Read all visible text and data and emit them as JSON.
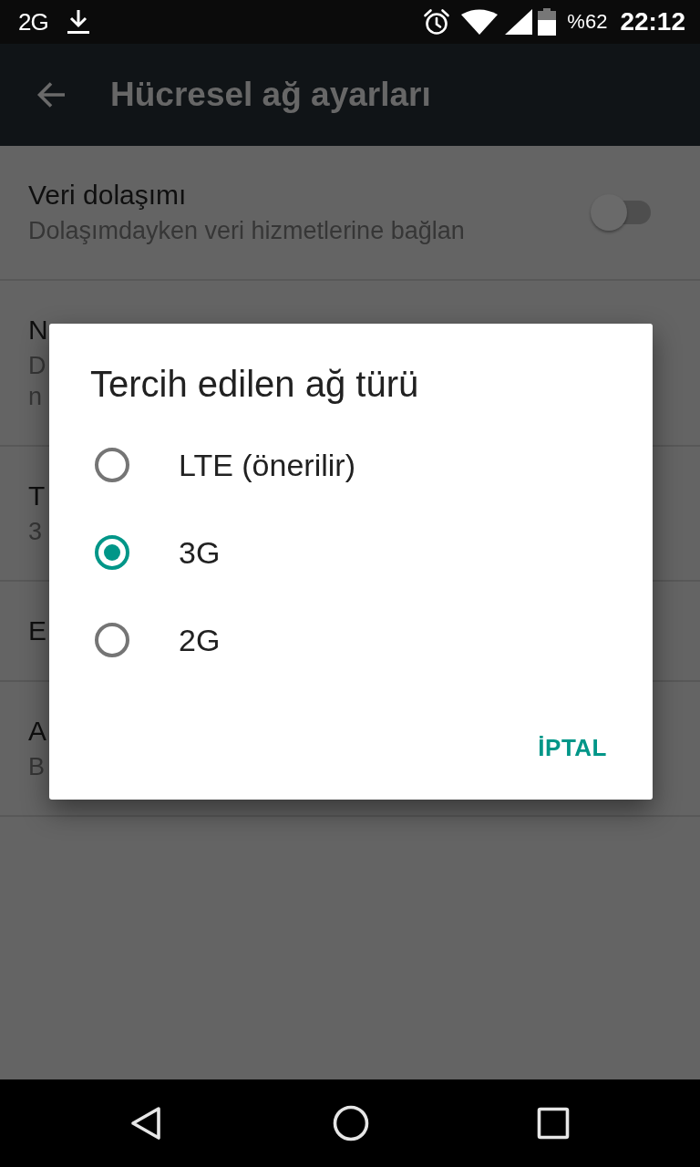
{
  "status_bar": {
    "network": "2G",
    "battery": "%62",
    "time": "22:12"
  },
  "app_bar": {
    "title": "Hücresel ağ ayarları"
  },
  "settings": [
    {
      "kind": "toggle",
      "title": "Veri dolaşımı",
      "summary": [
        "Dolaşımdayken veri hizmetlerine bağlan"
      ],
      "on": false
    },
    {
      "kind": "text",
      "title": "N",
      "summary": [
        "D",
        "n"
      ]
    },
    {
      "kind": "text",
      "title": "T",
      "summary": [
        "3"
      ]
    },
    {
      "kind": "text",
      "title": "E"
    },
    {
      "kind": "text",
      "title": "A",
      "summary": [
        "B"
      ]
    }
  ],
  "dialog": {
    "title": "Tercih edilen ağ türü",
    "options": [
      {
        "label": "LTE (önerilir)",
        "selected": false
      },
      {
        "label": "3G",
        "selected": true
      },
      {
        "label": "2G",
        "selected": false
      }
    ],
    "buttons": [
      "İPTAL"
    ]
  }
}
